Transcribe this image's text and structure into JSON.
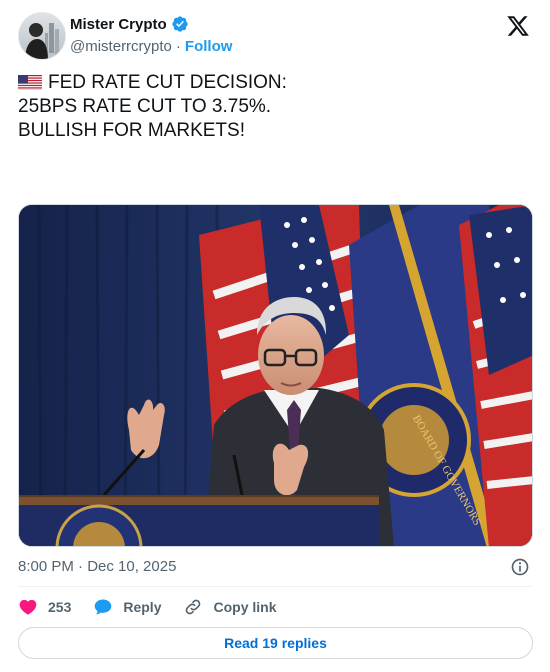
{
  "author": {
    "display_name": "Mister Crypto",
    "handle": "@misterrcrypto",
    "separator": "·",
    "follow_label": "Follow",
    "verified": true
  },
  "brand": {
    "logo": "x-logo-icon"
  },
  "tweet": {
    "flag_icon": "us-flag-icon",
    "lines": [
      "FED RATE CUT DECISION:",
      "25BPS RATE CUT TO 3.75%.",
      "BULLISH FOR MARKETS!"
    ]
  },
  "media": {
    "image_description_icon": "press-conference-photo",
    "seal_text": "BOARD OF GOVERNORS"
  },
  "meta": {
    "timestamp": "8:00 PM · Dec 10, 2025",
    "info_icon": "info-icon"
  },
  "actions": {
    "likes_count": "253",
    "reply_label": "Reply",
    "copy_link_label": "Copy link"
  },
  "replies_button": {
    "label": "Read 19 replies"
  },
  "colors": {
    "accent": "#1d9bf0",
    "like": "#f91880",
    "text_secondary": "#536471",
    "link_button": "#006fd6"
  }
}
